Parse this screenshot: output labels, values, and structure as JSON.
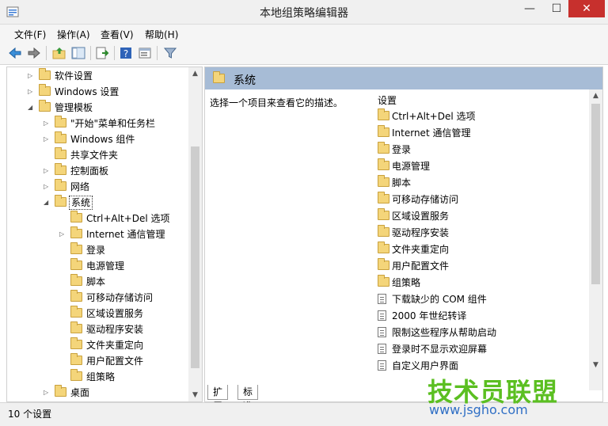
{
  "window": {
    "title": "本地组策略编辑器",
    "min_glyph": "—",
    "max_glyph": "☐",
    "close_glyph": "✕"
  },
  "menu": [
    "文件(F)",
    "操作(A)",
    "查看(V)",
    "帮助(H)"
  ],
  "toolbar_icons": [
    "back-arrow-icon",
    "forward-arrow-icon",
    "folder-up-icon",
    "show-hide-tree-icon",
    "export-list-icon",
    "help-icon",
    "properties-icon",
    "filter-icon"
  ],
  "tree": [
    {
      "label": "软件设置",
      "level": 1,
      "expander": "collapsed"
    },
    {
      "label": "Windows 设置",
      "level": 1,
      "expander": "collapsed"
    },
    {
      "label": "管理模板",
      "level": 1,
      "expander": "expanded"
    },
    {
      "label": "\"开始\"菜单和任务栏",
      "level": 2,
      "expander": "collapsed"
    },
    {
      "label": "Windows 组件",
      "level": 2,
      "expander": "collapsed"
    },
    {
      "label": "共享文件夹",
      "level": 2,
      "expander": "none"
    },
    {
      "label": "控制面板",
      "level": 2,
      "expander": "collapsed"
    },
    {
      "label": "网络",
      "level": 2,
      "expander": "collapsed"
    },
    {
      "label": "系统",
      "level": 2,
      "expander": "expanded",
      "selected": true
    },
    {
      "label": "Ctrl+Alt+Del 选项",
      "level": 3,
      "expander": "none"
    },
    {
      "label": "Internet 通信管理",
      "level": 3,
      "expander": "collapsed"
    },
    {
      "label": "登录",
      "level": 3,
      "expander": "none"
    },
    {
      "label": "电源管理",
      "level": 3,
      "expander": "none"
    },
    {
      "label": "脚本",
      "level": 3,
      "expander": "none"
    },
    {
      "label": "可移动存储访问",
      "level": 3,
      "expander": "none"
    },
    {
      "label": "区域设置服务",
      "level": 3,
      "expander": "none"
    },
    {
      "label": "驱动程序安装",
      "level": 3,
      "expander": "none"
    },
    {
      "label": "文件夹重定向",
      "level": 3,
      "expander": "none"
    },
    {
      "label": "用户配置文件",
      "level": 3,
      "expander": "none"
    },
    {
      "label": "组策略",
      "level": 3,
      "expander": "none"
    },
    {
      "label": "桌面",
      "level": 2,
      "expander": "collapsed"
    }
  ],
  "right": {
    "header_title": "系统",
    "description": "选择一个项目来查看它的描述。",
    "list_header": "设置",
    "items": [
      {
        "label": "Ctrl+Alt+Del 选项",
        "kind": "folder"
      },
      {
        "label": "Internet 通信管理",
        "kind": "folder"
      },
      {
        "label": "登录",
        "kind": "folder"
      },
      {
        "label": "电源管理",
        "kind": "folder"
      },
      {
        "label": "脚本",
        "kind": "folder"
      },
      {
        "label": "可移动存储访问",
        "kind": "folder"
      },
      {
        "label": "区域设置服务",
        "kind": "folder"
      },
      {
        "label": "驱动程序安装",
        "kind": "folder"
      },
      {
        "label": "文件夹重定向",
        "kind": "folder"
      },
      {
        "label": "用户配置文件",
        "kind": "folder"
      },
      {
        "label": "组策略",
        "kind": "folder"
      },
      {
        "label": "下载缺少的 COM 组件",
        "kind": "policy"
      },
      {
        "label": "2000 年世纪转译",
        "kind": "policy"
      },
      {
        "label": "限制这些程序从帮助启动",
        "kind": "policy"
      },
      {
        "label": "登录时不显示欢迎屏幕",
        "kind": "policy"
      },
      {
        "label": "自定义用户界面",
        "kind": "policy"
      }
    ]
  },
  "tabs": [
    "扩展",
    "标准"
  ],
  "status": "10 个设置",
  "watermark": {
    "big": "技术员联盟",
    "small": "www.jsgho.com"
  },
  "colors": {
    "header_bg": "#a7bcd6",
    "close_btn": "#c7302d",
    "folder": "#f4d57a",
    "watermark_green": "#5bbf21"
  }
}
